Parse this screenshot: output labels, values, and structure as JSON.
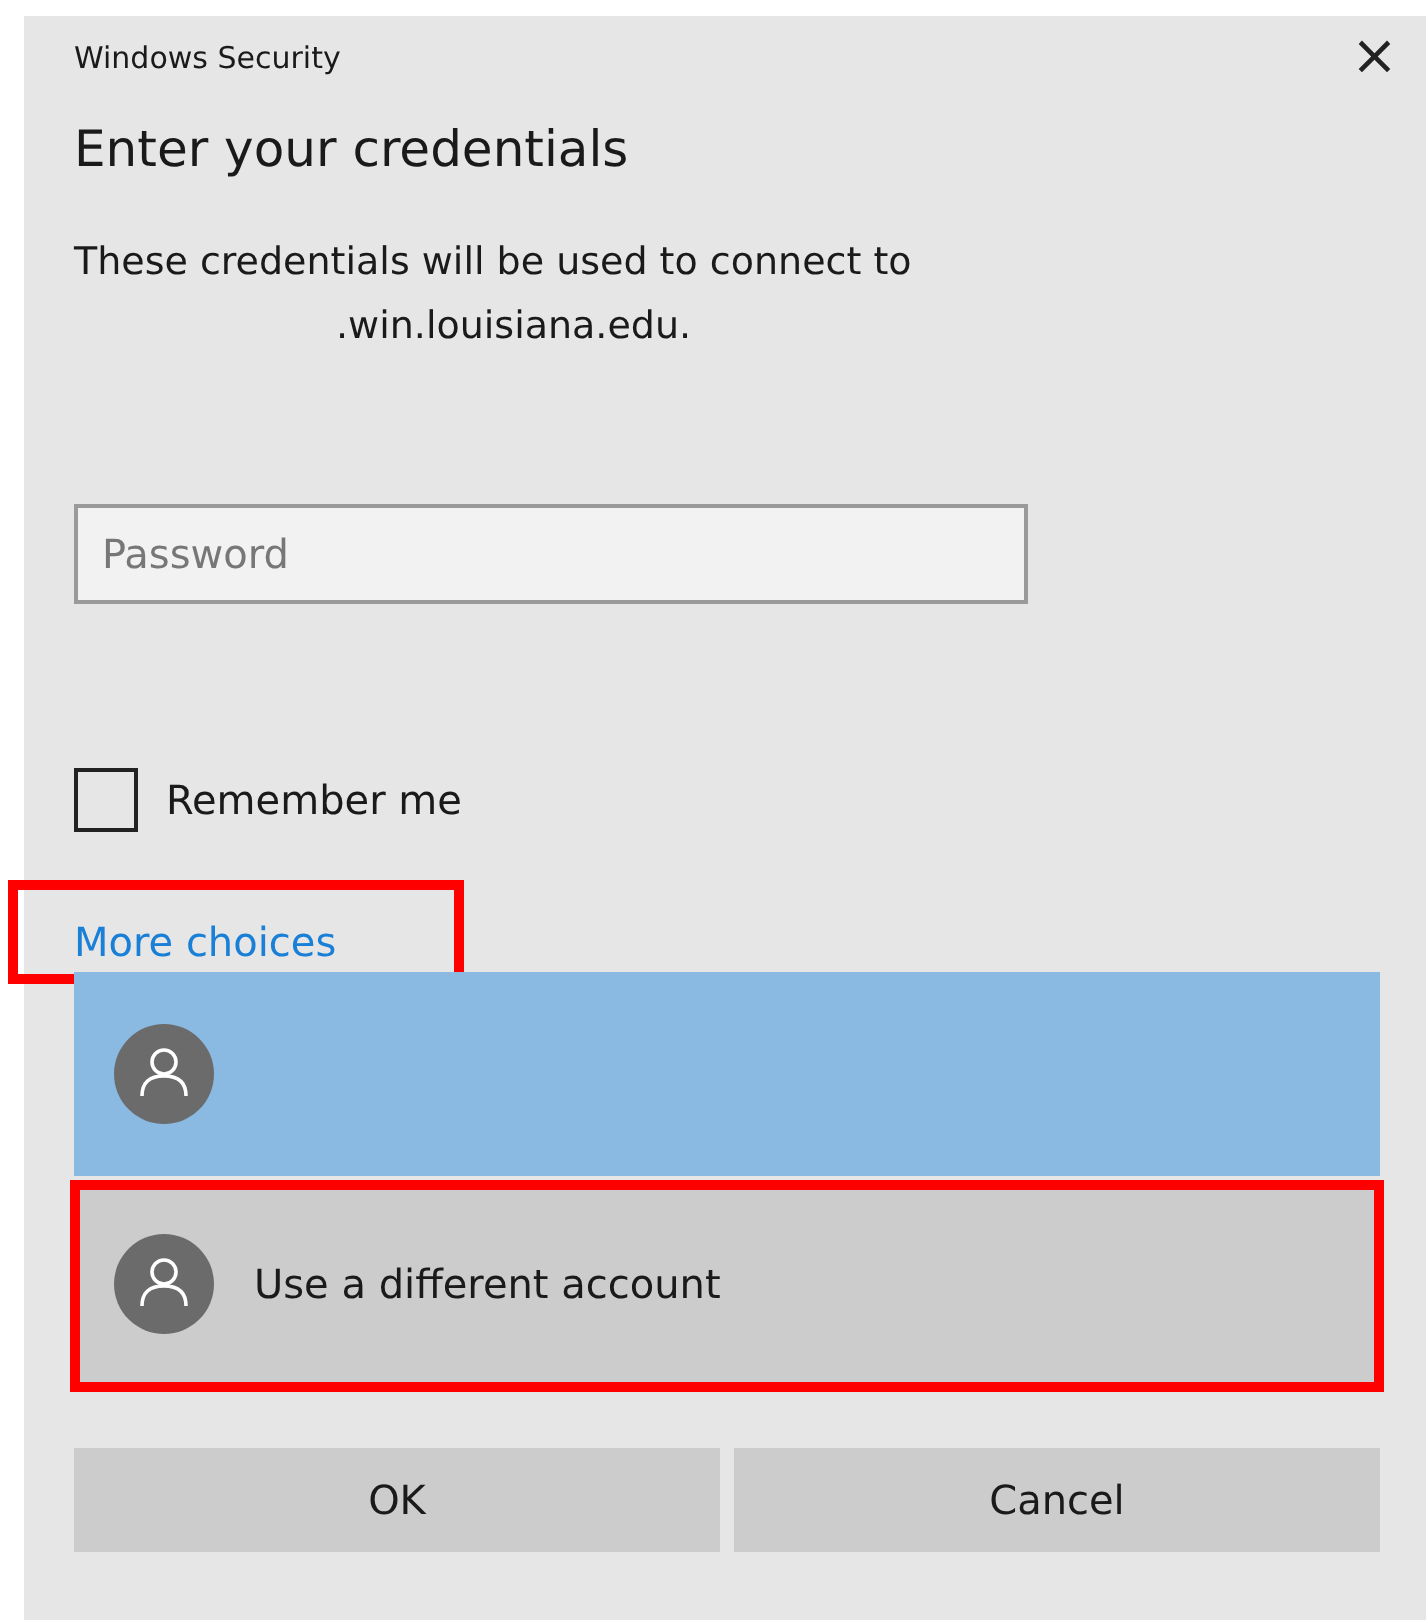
{
  "window": {
    "title": "Windows Security",
    "close": "×"
  },
  "heading": "Enter your credentials",
  "message": [
    "These credentials will be used to connect to",
    ".win.louisiana.edu."
  ],
  "password": {
    "placeholder": "Password"
  },
  "remember": {
    "label": "Remember me",
    "checked": false
  },
  "more_choices": {
    "label": "More choices",
    "highlighted": true
  },
  "accounts": [
    {
      "selected": true,
      "highlighted": false
    },
    {
      "name": "Use a different account",
      "selected": false,
      "highlighted": true
    }
  ],
  "buttons": [
    "OK",
    "Cancel"
  ]
}
